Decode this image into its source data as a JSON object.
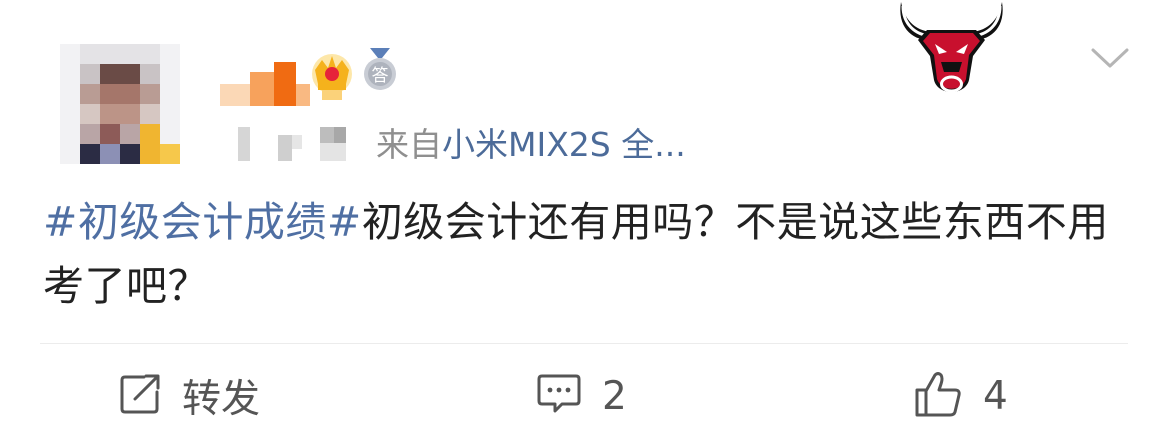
{
  "post": {
    "source_prefix": "来自",
    "source_device": "小米MIX2S 全...",
    "tag_text": "#初级会计成绩#",
    "body_text": "初级会计还有用吗？不是说这些东西不用考了吧？"
  },
  "badges": {
    "medal_char": "答"
  },
  "actions": {
    "repost_label": "转发",
    "comment_count": "2",
    "like_count": "4"
  },
  "colors": {
    "link": "#4f6fa3",
    "text": "#222222",
    "secondary": "#8f8f8f",
    "bull_red": "#c8102e"
  },
  "icons": {
    "avatar": "pixelated-avatar",
    "crown": "crown-icon",
    "medal": "medal-icon",
    "team_logo": "bulls-logo-icon",
    "menu": "chevron-down-icon",
    "repost": "repost-icon",
    "comment": "comment-icon",
    "like": "thumbs-up-icon"
  }
}
